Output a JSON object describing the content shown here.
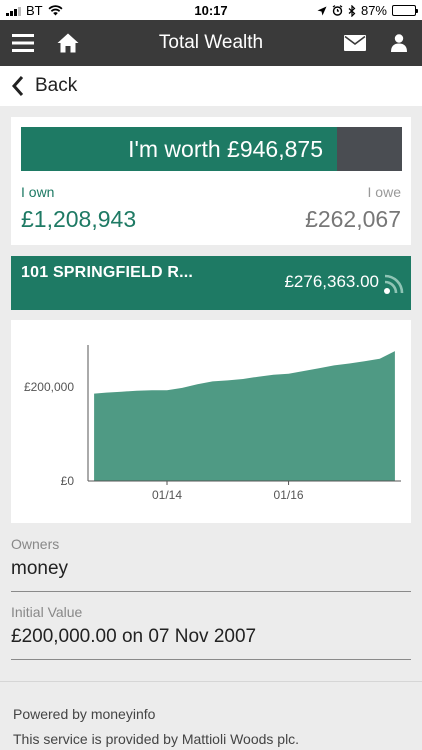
{
  "status_bar": {
    "carrier": "BT",
    "time": "10:17",
    "battery": "87%",
    "battery_level": 0.87,
    "icons": [
      "signal-icon",
      "wifi-icon",
      "location-icon",
      "alarm-icon",
      "bluetooth-icon",
      "battery-icon"
    ]
  },
  "nav": {
    "title": "Total Wealth",
    "icons": [
      "menu-icon",
      "home-icon",
      "mail-icon",
      "user-icon"
    ]
  },
  "back": {
    "label": "Back"
  },
  "summary": {
    "worth_text": "I'm worth £946,875",
    "worth_fraction": 0.83,
    "own_label": "I own",
    "own_value": "£1,208,943",
    "owe_label": "I owe",
    "owe_value": "£262,067",
    "colors": {
      "accent": "#1e7a64",
      "owe_bar": "#4a4d52"
    }
  },
  "property": {
    "name": "101 SPRINGFIELD R...",
    "amount": "£276,363.00",
    "icon": "rss-icon"
  },
  "chart_data": {
    "type": "area",
    "x_ticks": [
      "01/14",
      "01/16"
    ],
    "y_ticks": [
      "£200,000",
      "£0"
    ],
    "ylim": [
      0,
      300000
    ],
    "color": "#4f9a84",
    "series": [
      {
        "x": [
          2012.8,
          2013.0,
          2013.25,
          2013.5,
          2013.75,
          2014.0,
          2014.25,
          2014.5,
          2014.75,
          2015.0,
          2015.25,
          2015.5,
          2015.75,
          2016.0,
          2016.25,
          2016.5,
          2016.75,
          2017.0,
          2017.25,
          2017.5,
          2017.75
        ],
        "values": [
          186000,
          188000,
          190000,
          192000,
          193000,
          193000,
          198000,
          206000,
          212000,
          214000,
          217000,
          222000,
          226000,
          228000,
          234000,
          240000,
          246000,
          250000,
          255000,
          260000,
          276363
        ]
      }
    ],
    "xlim": [
      2012.7,
      2017.85
    ]
  },
  "owners": {
    "label": "Owners",
    "value": "money"
  },
  "initial_value": {
    "label": "Initial Value",
    "value": "£200,000.00 on 07 Nov 2007"
  },
  "footer": {
    "powered": "Powered by moneyinfo",
    "service": "This service is provided by Mattioli Woods plc."
  }
}
